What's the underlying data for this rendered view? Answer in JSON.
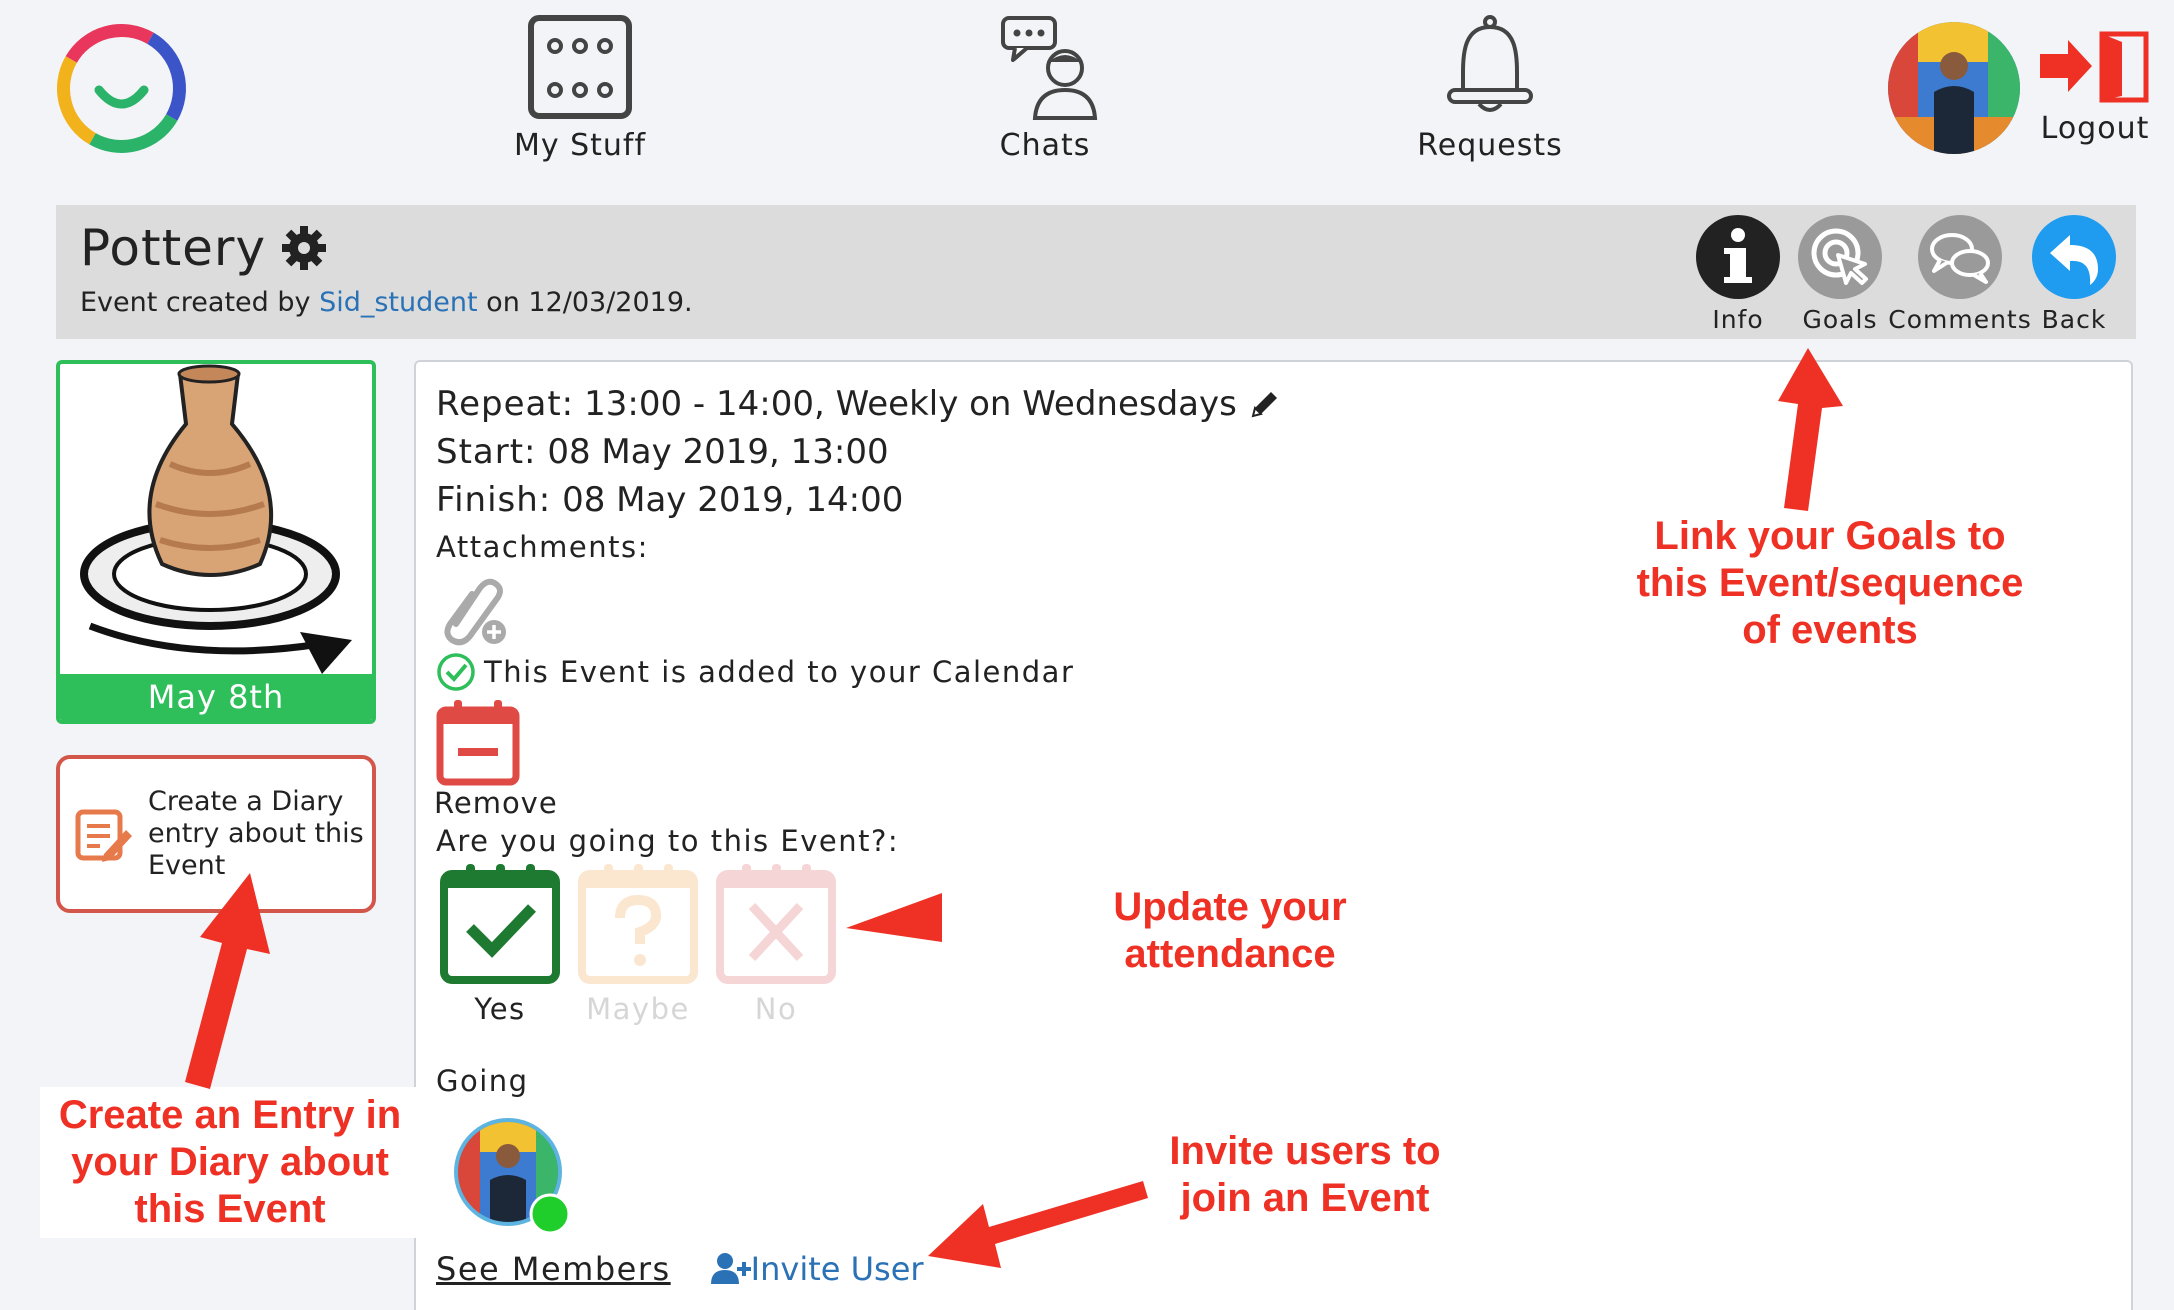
{
  "nav": {
    "my_stuff": "My Stuff",
    "chats": "Chats",
    "requests": "Requests",
    "logout": "Logout"
  },
  "event": {
    "title": "Pottery",
    "created_prefix": "Event created by",
    "author": "Sid_student",
    "created_suffix": "on 12/03/2019.",
    "date_label": "May 8th"
  },
  "header_buttons": {
    "info": "Info",
    "goals": "Goals",
    "comments": "Comments",
    "back": "Back"
  },
  "details": {
    "repeat_label": "Repeat:",
    "repeat_value": "13:00 - 14:00, Weekly on Wednesdays",
    "start_label": "Start:",
    "start_value": "08 May 2019, 13:00",
    "finish_label": "Finish:",
    "finish_value": "08 May 2019, 14:00",
    "attachments_label": "Attachments:",
    "calendar_status": "This Event is added to your Calendar",
    "remove_label": "Remove",
    "attendance_question": "Are you going to this Event?:",
    "attendance_selected": "Yes",
    "attendance_options": [
      "Yes",
      "Maybe",
      "No"
    ],
    "going_label": "Going",
    "see_members": "See Members",
    "invite_user": "Invite User"
  },
  "diary_button": {
    "line1": "Create a Diary",
    "line2": "entry about this",
    "line3": "Event"
  },
  "annotations": {
    "goals_note": [
      "Link your Goals to",
      "this Event/sequence",
      "of events"
    ],
    "attendance_note": [
      "Update your",
      "attendance"
    ],
    "diary_note": [
      "Create an Entry in",
      "your Diary about",
      "this Event"
    ],
    "invite_note": [
      "Invite users to",
      "join an Event"
    ]
  },
  "colors": {
    "accent_green": "#2fbf5a",
    "diary_border": "#d2574a",
    "link_blue": "#2a72b5",
    "annotation_red": "#ee3124",
    "back_blue": "#1f9cef",
    "remove_red": "#e04a44"
  }
}
